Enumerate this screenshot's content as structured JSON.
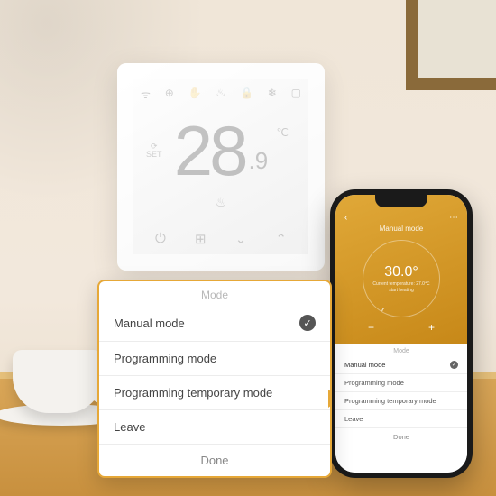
{
  "thermostat": {
    "set_label_top": "⟳",
    "set_label": "SET",
    "main_temp": "28",
    "decimal_temp": ".9",
    "unit": "℃",
    "icons": {
      "wifi": "ᯤ",
      "clock": "⊕",
      "manual": "✋",
      "flame": "♨",
      "lock": "🔒",
      "frost": "❄",
      "window": "▢"
    },
    "heat_icon": "♨",
    "controls": {
      "power": "⏻",
      "menu": "⊞",
      "down": "⌄",
      "up": "⌃"
    }
  },
  "phone": {
    "back": "‹",
    "menu": "⋯",
    "header_mode": "Manual mode",
    "dial_temp": "30.0°",
    "dial_current": "Current temperature: 27.0℃",
    "dial_status": "start heating",
    "minus": "−",
    "plus": "+",
    "sheet": {
      "title": "Mode",
      "options": [
        {
          "label": "Manual mode",
          "selected": true
        },
        {
          "label": "Programming mode",
          "selected": false
        },
        {
          "label": "Programming temporary mode",
          "selected": false
        },
        {
          "label": "Leave",
          "selected": false
        }
      ],
      "done": "Done"
    }
  },
  "popup": {
    "title": "Mode",
    "options": [
      {
        "label": "Manual mode",
        "selected": true
      },
      {
        "label": "Programming mode",
        "selected": false
      },
      {
        "label": "Programming temporary mode",
        "selected": false
      },
      {
        "label": "Leave",
        "selected": false
      }
    ],
    "done": "Done",
    "check": "✓"
  }
}
